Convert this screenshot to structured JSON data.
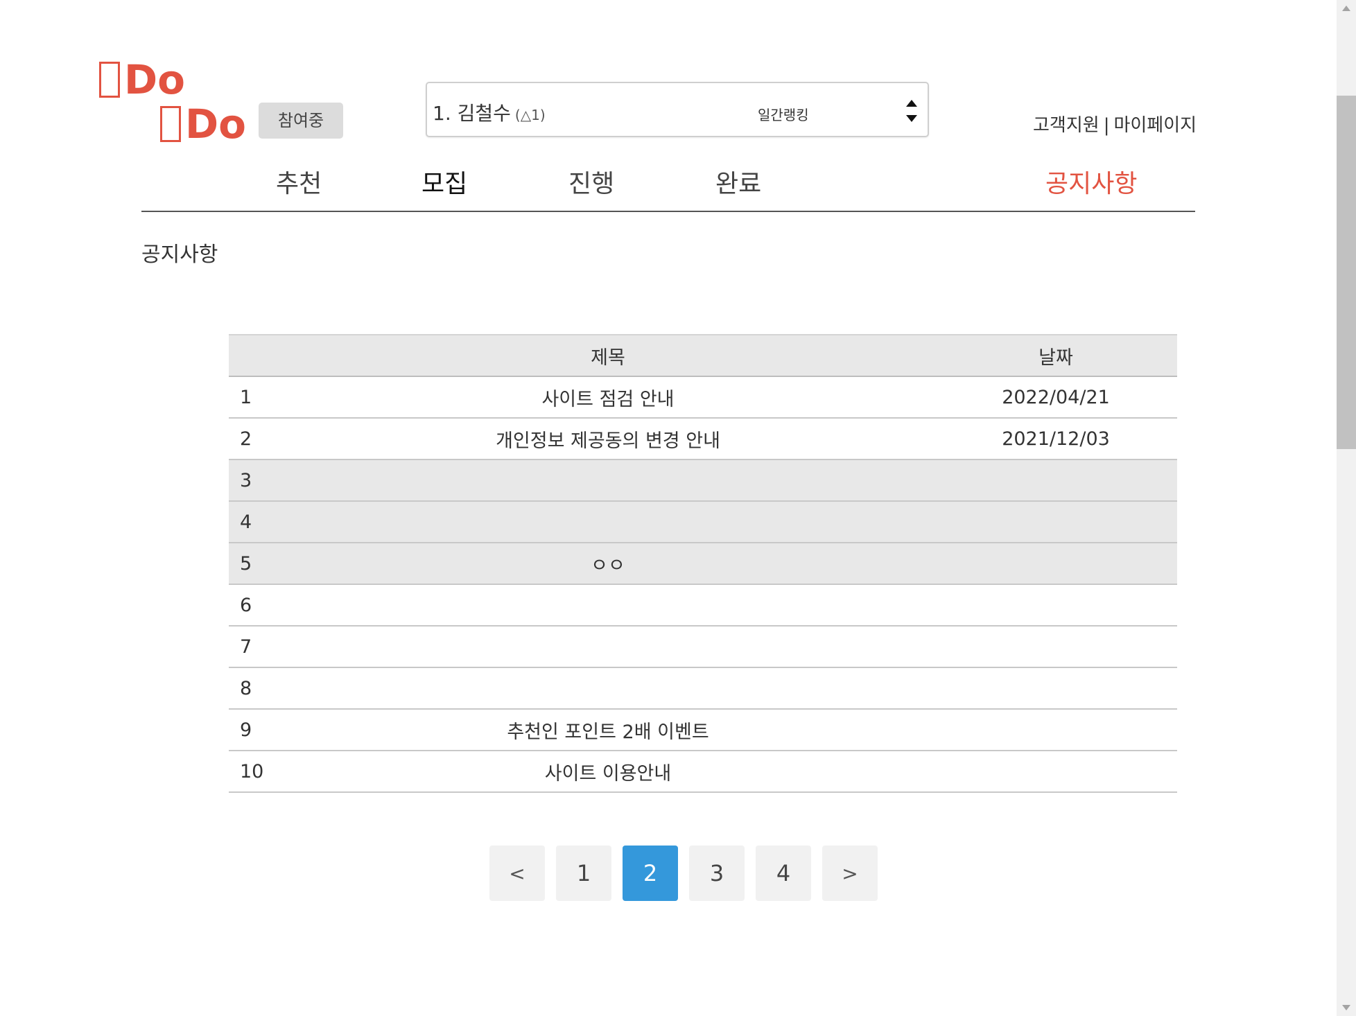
{
  "logo": {
    "line1": "Do",
    "line2": "Do"
  },
  "status_badge": "참여중",
  "ranking": {
    "entry": "1. 김철수",
    "change": "(△1)",
    "label": "일간랭킹"
  },
  "top_links": {
    "support": "고객지원",
    "separator": "|",
    "mypage": "마이페이지"
  },
  "nav": {
    "items": [
      {
        "label": "추천"
      },
      {
        "label": "모집"
      },
      {
        "label": "진행"
      },
      {
        "label": "완료"
      },
      {
        "label": "공지사항"
      }
    ],
    "active": "공지사항",
    "accent_color": "#e25341"
  },
  "section_title": "공지사항",
  "table": {
    "headers": {
      "no": "",
      "title": "제목",
      "date": "날짜"
    },
    "rows": [
      {
        "no": "1",
        "title": "사이트 점검 안내",
        "date": "2022/04/21"
      },
      {
        "no": "2",
        "title": "개인정보 제공동의 변경 안내",
        "date": "2021/12/03"
      },
      {
        "no": "3",
        "title": "",
        "date": ""
      },
      {
        "no": "4",
        "title": "",
        "date": ""
      },
      {
        "no": "5",
        "title": "ㅇㅇ",
        "date": ""
      },
      {
        "no": "6",
        "title": "",
        "date": ""
      },
      {
        "no": "7",
        "title": "",
        "date": ""
      },
      {
        "no": "8",
        "title": "",
        "date": ""
      },
      {
        "no": "9",
        "title": "추천인 포인트 2배 이벤트",
        "date": ""
      },
      {
        "no": "10",
        "title": "사이트 이용안내",
        "date": ""
      }
    ]
  },
  "pagination": {
    "prev": "<",
    "pages": [
      "1",
      "2",
      "3",
      "4"
    ],
    "current": "2",
    "next": ">",
    "current_color": "#3498db"
  }
}
